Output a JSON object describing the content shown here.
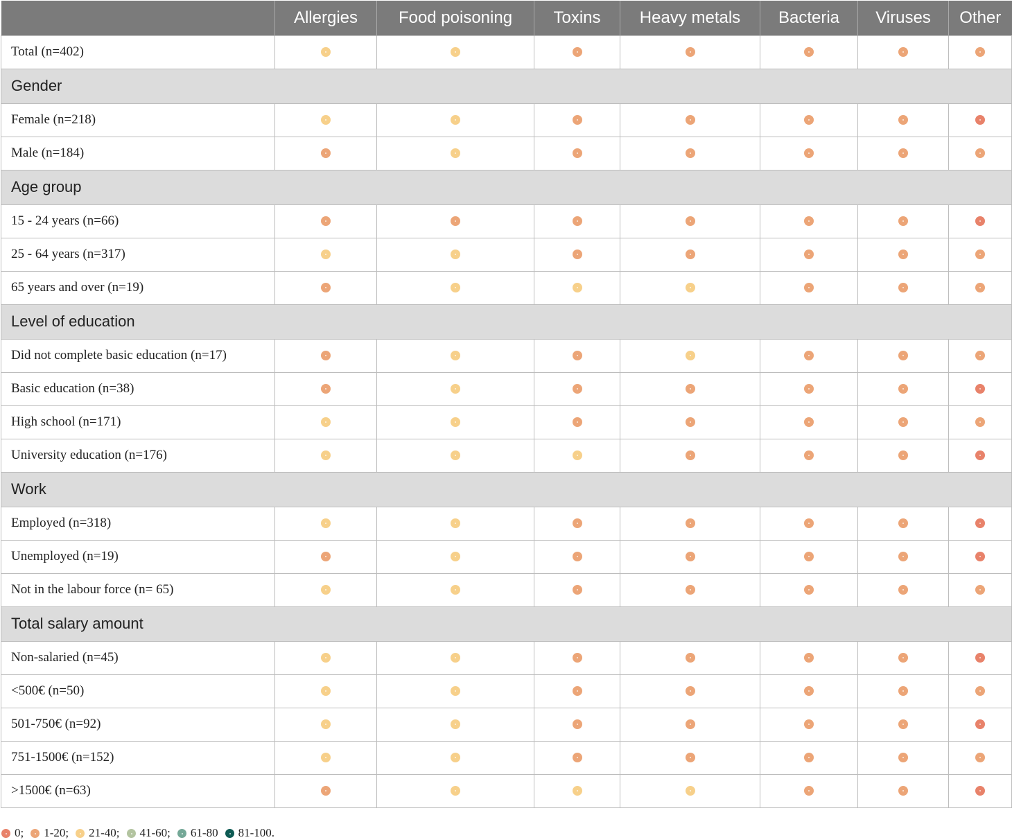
{
  "columns": [
    "",
    "Allergies",
    "Food poisoning",
    "Toxins",
    "Heavy metals",
    "Bacteria",
    "Viruses",
    "Other"
  ],
  "colors": {
    "0": "#e8826a",
    "1": "#eca577",
    "2": "#f7d08a",
    "3": "#b3c4a0",
    "4": "#74a897",
    "5": "#0e5b54"
  },
  "rows": [
    {
      "label": "Total (n=402)",
      "levels": [
        2,
        2,
        1,
        1,
        1,
        1,
        1
      ]
    },
    {
      "section": "Gender"
    },
    {
      "label": "Female (n=218)",
      "levels": [
        2,
        2,
        1,
        1,
        1,
        1,
        0
      ]
    },
    {
      "label": "Male (n=184)",
      "levels": [
        1,
        2,
        1,
        1,
        1,
        1,
        1
      ]
    },
    {
      "section": "Age group"
    },
    {
      "label": "15 - 24 years (n=66)",
      "levels": [
        1,
        1,
        1,
        1,
        1,
        1,
        0
      ]
    },
    {
      "label": "25 - 64 years (n=317)",
      "levels": [
        2,
        2,
        1,
        1,
        1,
        1,
        1
      ]
    },
    {
      "label": "65 years and over (n=19)",
      "levels": [
        1,
        2,
        2,
        2,
        1,
        1,
        1
      ]
    },
    {
      "section": "Level of education"
    },
    {
      "label": "Did not complete basic education (n=17)",
      "levels": [
        1,
        2,
        1,
        2,
        1,
        1,
        1
      ]
    },
    {
      "label": "Basic education (n=38)",
      "levels": [
        1,
        2,
        1,
        1,
        1,
        1,
        0
      ]
    },
    {
      "label": "High school (n=171)",
      "levels": [
        2,
        2,
        1,
        1,
        1,
        1,
        1
      ]
    },
    {
      "label": "University education (n=176)",
      "levels": [
        2,
        2,
        2,
        1,
        1,
        1,
        0
      ]
    },
    {
      "section": "Work"
    },
    {
      "label": "Employed (n=318)",
      "levels": [
        2,
        2,
        1,
        1,
        1,
        1,
        0
      ]
    },
    {
      "label": "Unemployed (n=19)",
      "levels": [
        1,
        2,
        1,
        1,
        1,
        1,
        0
      ]
    },
    {
      "label": "Not in the labour force (n= 65)",
      "levels": [
        2,
        2,
        1,
        1,
        1,
        1,
        1
      ]
    },
    {
      "section": "Total salary amount"
    },
    {
      "label": "Non-salaried (n=45)",
      "levels": [
        2,
        2,
        1,
        1,
        1,
        1,
        0
      ]
    },
    {
      "label": "<500€ (n=50)",
      "levels": [
        2,
        2,
        1,
        1,
        1,
        1,
        1
      ]
    },
    {
      "label": "501-750€ (n=92)",
      "levels": [
        2,
        2,
        1,
        1,
        1,
        1,
        0
      ]
    },
    {
      "label": "751-1500€ (n=152)",
      "levels": [
        2,
        2,
        1,
        1,
        1,
        1,
        1
      ]
    },
    {
      "label": ">1500€ (n=63)",
      "levels": [
        1,
        2,
        2,
        2,
        1,
        1,
        0
      ]
    }
  ],
  "legend": [
    {
      "level": 0,
      "label": "0;"
    },
    {
      "level": 1,
      "label": "1-20;"
    },
    {
      "level": 2,
      "label": "21-40;"
    },
    {
      "level": 3,
      "label": "41-60;"
    },
    {
      "level": 4,
      "label": "61-80"
    },
    {
      "level": 5,
      "label": "81-100."
    }
  ]
}
